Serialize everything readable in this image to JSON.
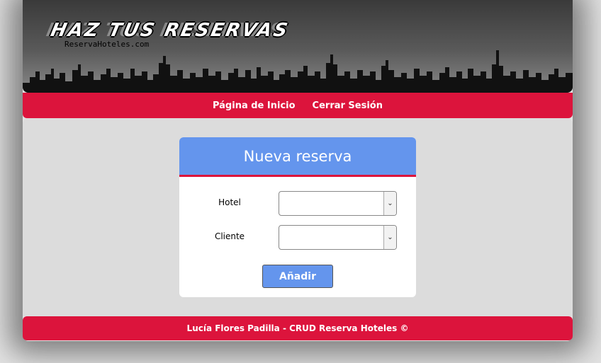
{
  "header": {
    "logo_title": "HAZ TUS RESERVAS",
    "logo_subtitle": "ReservaHoteles.com"
  },
  "nav": {
    "items": [
      {
        "label": "Página de Inicio"
      },
      {
        "label": "Cerrar Sesión"
      }
    ]
  },
  "form": {
    "title": "Nueva reserva",
    "fields": [
      {
        "label": "Hotel",
        "value": ""
      },
      {
        "label": "Cliente",
        "value": ""
      }
    ],
    "submit_label": "Añadir"
  },
  "footer": {
    "text": "Lucía Flores Padilla - CRUD Reserva Hoteles ©"
  },
  "colors": {
    "accent": "#dc143c",
    "card_header": "#6495ed",
    "background": "#dcdcdc"
  }
}
